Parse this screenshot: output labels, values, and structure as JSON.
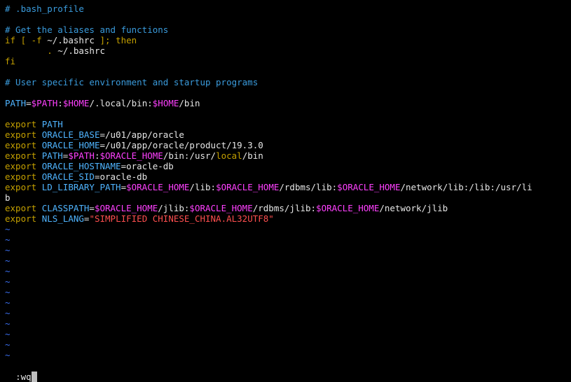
{
  "editor": {
    "lines": [
      [
        {
          "t": "# .bash_profile",
          "c": "comment"
        }
      ],
      [],
      [
        {
          "t": "# Get the aliases and functions",
          "c": "comment"
        }
      ],
      [
        {
          "t": "if",
          "c": "keyword"
        },
        {
          "t": " [ -f ",
          "c": "keyword"
        },
        {
          "t": "~/.bashrc",
          "c": "normal"
        },
        {
          "t": " ]; ",
          "c": "keyword"
        },
        {
          "t": "then",
          "c": "keyword"
        }
      ],
      [
        {
          "t": "        . ",
          "c": "yellow"
        },
        {
          "t": "~/.bashrc",
          "c": "normal"
        }
      ],
      [
        {
          "t": "fi",
          "c": "keyword"
        }
      ],
      [],
      [
        {
          "t": "# User specific environment and startup programs",
          "c": "comment"
        }
      ],
      [],
      [
        {
          "t": "PATH",
          "c": "ident"
        },
        {
          "t": "=",
          "c": "normal"
        },
        {
          "t": "$PATH",
          "c": "var"
        },
        {
          "t": ":",
          "c": "normal"
        },
        {
          "t": "$HOME",
          "c": "var"
        },
        {
          "t": "/.local/bin:",
          "c": "normal"
        },
        {
          "t": "$HOME",
          "c": "var"
        },
        {
          "t": "/bin",
          "c": "normal"
        }
      ],
      [],
      [
        {
          "t": "export",
          "c": "keyword"
        },
        {
          "t": " ",
          "c": "normal"
        },
        {
          "t": "PATH",
          "c": "ident"
        }
      ],
      [
        {
          "t": "export",
          "c": "keyword"
        },
        {
          "t": " ",
          "c": "normal"
        },
        {
          "t": "ORACLE_BASE",
          "c": "ident"
        },
        {
          "t": "=/u01/app/oracle",
          "c": "normal"
        }
      ],
      [
        {
          "t": "export",
          "c": "keyword"
        },
        {
          "t": " ",
          "c": "normal"
        },
        {
          "t": "ORACLE_HOME",
          "c": "ident"
        },
        {
          "t": "=/u01/app/oracle/product/19.3.0",
          "c": "normal"
        }
      ],
      [
        {
          "t": "export",
          "c": "keyword"
        },
        {
          "t": " ",
          "c": "normal"
        },
        {
          "t": "PATH",
          "c": "ident"
        },
        {
          "t": "=",
          "c": "normal"
        },
        {
          "t": "$PATH",
          "c": "var"
        },
        {
          "t": ":",
          "c": "normal"
        },
        {
          "t": "$ORACLE_HOME",
          "c": "var"
        },
        {
          "t": "/bin:/usr/",
          "c": "normal"
        },
        {
          "t": "local",
          "c": "yellow"
        },
        {
          "t": "/bin",
          "c": "normal"
        }
      ],
      [
        {
          "t": "export",
          "c": "keyword"
        },
        {
          "t": " ",
          "c": "normal"
        },
        {
          "t": "ORACLE_HOSTNAME",
          "c": "ident"
        },
        {
          "t": "=oracle-db",
          "c": "normal"
        }
      ],
      [
        {
          "t": "export",
          "c": "keyword"
        },
        {
          "t": " ",
          "c": "normal"
        },
        {
          "t": "ORACLE_SID",
          "c": "ident"
        },
        {
          "t": "=oracle-db",
          "c": "normal"
        }
      ],
      [
        {
          "t": "export",
          "c": "keyword"
        },
        {
          "t": " ",
          "c": "normal"
        },
        {
          "t": "LD_LIBRARY_PATH",
          "c": "ident"
        },
        {
          "t": "=",
          "c": "normal"
        },
        {
          "t": "$ORACLE_HOME",
          "c": "var"
        },
        {
          "t": "/lib:",
          "c": "normal"
        },
        {
          "t": "$ORACLE_HOME",
          "c": "var"
        },
        {
          "t": "/rdbms/lib:",
          "c": "normal"
        },
        {
          "t": "$ORACLE_HOME",
          "c": "var"
        },
        {
          "t": "/network/lib:/lib:/usr/li",
          "c": "normal"
        }
      ],
      [
        {
          "t": "b",
          "c": "normal"
        }
      ],
      [
        {
          "t": "export",
          "c": "keyword"
        },
        {
          "t": " ",
          "c": "normal"
        },
        {
          "t": "CLASSPATH",
          "c": "ident"
        },
        {
          "t": "=",
          "c": "normal"
        },
        {
          "t": "$ORACLE_HOME",
          "c": "var"
        },
        {
          "t": "/jlib:",
          "c": "normal"
        },
        {
          "t": "$ORACLE_HOME",
          "c": "var"
        },
        {
          "t": "/rdbms/jlib:",
          "c": "normal"
        },
        {
          "t": "$ORACLE_HOME",
          "c": "var"
        },
        {
          "t": "/network/jlib",
          "c": "normal"
        }
      ],
      [
        {
          "t": "export",
          "c": "keyword"
        },
        {
          "t": " ",
          "c": "normal"
        },
        {
          "t": "NLS_LANG",
          "c": "ident"
        },
        {
          "t": "=",
          "c": "normal"
        },
        {
          "t": "\"SIMPLIFIED CHINESE_CHINA.AL32UTF8\"",
          "c": "string"
        }
      ],
      [
        {
          "t": "~",
          "c": "tilde"
        }
      ],
      [
        {
          "t": "~",
          "c": "tilde"
        }
      ],
      [
        {
          "t": "~",
          "c": "tilde"
        }
      ],
      [
        {
          "t": "~",
          "c": "tilde"
        }
      ],
      [
        {
          "t": "~",
          "c": "tilde"
        }
      ],
      [
        {
          "t": "~",
          "c": "tilde"
        }
      ],
      [
        {
          "t": "~",
          "c": "tilde"
        }
      ],
      [
        {
          "t": "~",
          "c": "tilde"
        }
      ],
      [
        {
          "t": "~",
          "c": "tilde"
        }
      ],
      [
        {
          "t": "~",
          "c": "tilde"
        }
      ],
      [
        {
          "t": "~",
          "c": "tilde"
        }
      ],
      [
        {
          "t": "~",
          "c": "tilde"
        }
      ],
      [
        {
          "t": "~",
          "c": "tilde"
        }
      ]
    ]
  },
  "command_line": {
    "text": ":wq"
  },
  "colors": {
    "background": "#000000",
    "comment": "#3a9bdc",
    "keyword": "#c4a000",
    "variable": "#ff40ff",
    "identifier": "#4fb4ff",
    "string": "#ff4f4f",
    "tilde": "#3a6ff0",
    "text": "#e6e6e6"
  }
}
